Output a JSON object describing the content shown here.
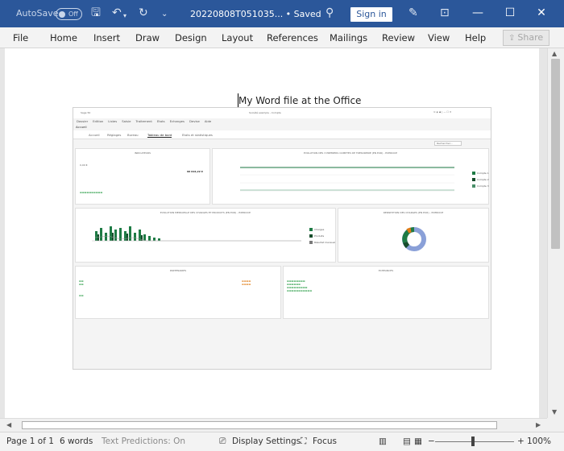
{
  "titlebar": {
    "autosave_label": "AutoSave",
    "autosave_state": "Off",
    "doc_title": "20220808T051035... • Saved",
    "signin_label": "Sign in"
  },
  "ribbon": {
    "menu": [
      "File",
      "Home",
      "Insert",
      "Draw",
      "Design",
      "Layout",
      "References",
      "Mailings",
      "Review",
      "View",
      "Help"
    ],
    "share_label": "Share"
  },
  "document": {
    "text": "My Word file at the Office"
  },
  "statusbar": {
    "page": "Page 1 of 1",
    "words": "6 words",
    "predictions": "Text Predictions: On",
    "display_settings": "Display Settings",
    "focus": "Focus",
    "zoom": "100%"
  },
  "colors": {
    "word_blue": "#2b579a",
    "accent_green": "#1e7b45",
    "dark_green": "#174d2c"
  },
  "embedded": {
    "app_title": "Sage 50",
    "window_title": "Société exemple - Compta",
    "menu": [
      "Dossier",
      "Edition",
      "Listes",
      "Saisie",
      "Traitement",
      "Etats",
      "Echanges",
      "Devise",
      "Aide"
    ],
    "home_label": "Accueil",
    "tabs": [
      "Accueil",
      "Réglages",
      "Bureau",
      "Tableau de bord",
      "Etats et statistiques"
    ],
    "search_placeholder": "Rechercher...",
    "cards": {
      "indicators": "INDICATEURS",
      "evolution": "EVOLUTION DES 3 PREMIERS COMPTES DE TRESORERIE (EN EUR) - EXERCICE",
      "monthly": "EVOLUTION MENSUELLE DES CHARGES ET PRODUITS (EN EUR) - EXERCICE",
      "donut": "REPARTITION DES CHARGES (EN EUR) - EXERCICE",
      "partners": "PARTENAIRES",
      "echeances": "ECHEANCES"
    },
    "indicator_value": "96 016,22 €",
    "indicator_small": "0,00 €",
    "legend_treasury": [
      "Compte 1",
      "Compte 2",
      "Compte 3"
    ],
    "legend_monthly": [
      "Charges",
      "Produits",
      "Résultat mensuel"
    ]
  }
}
